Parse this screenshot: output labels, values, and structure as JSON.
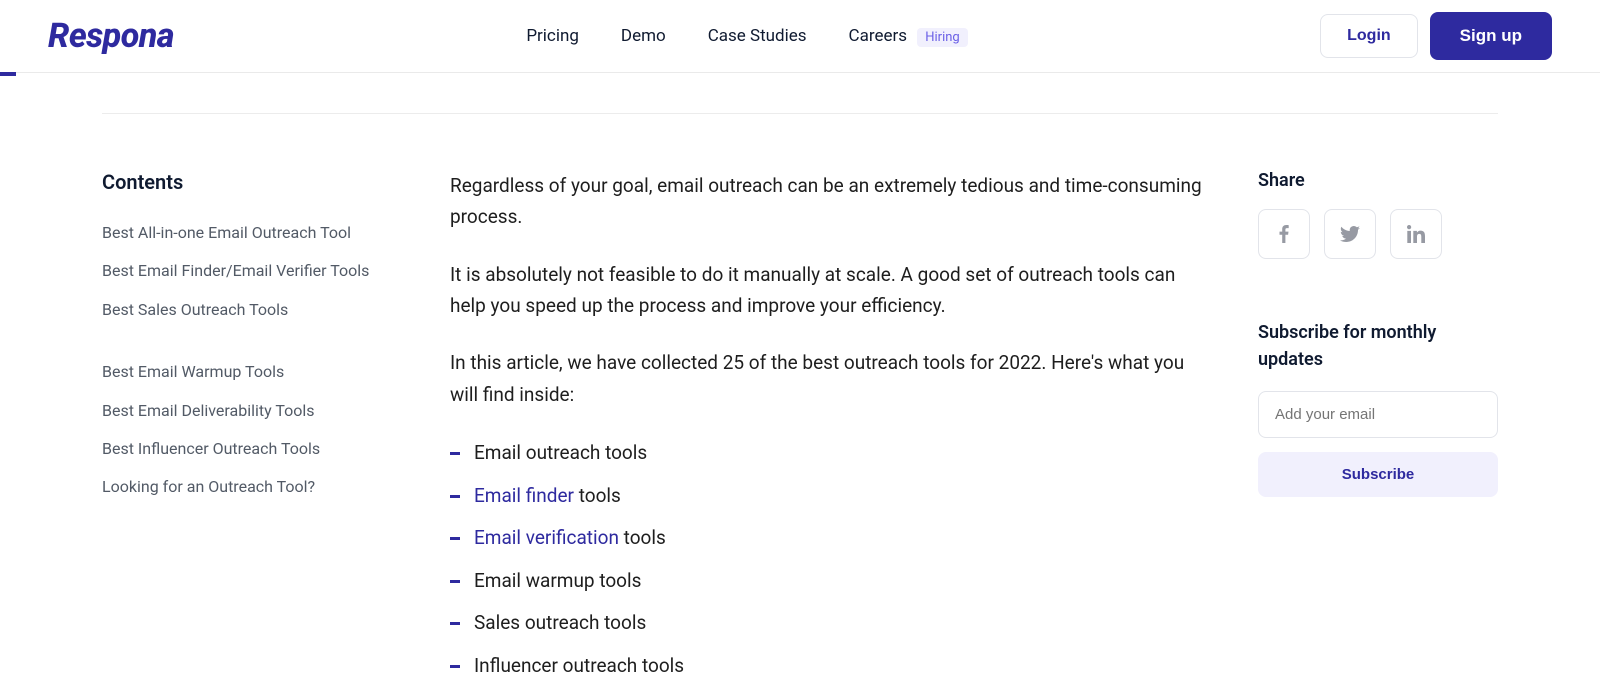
{
  "header": {
    "logo": "Respona",
    "nav": {
      "pricing": "Pricing",
      "demo": "Demo",
      "case_studies": "Case Studies",
      "careers": "Careers",
      "hiring_badge": "Hiring"
    },
    "auth": {
      "login": "Login",
      "signup": "Sign up"
    }
  },
  "contents": {
    "heading": "Contents",
    "items": [
      "Best All-in-one Email Outreach Tool",
      "Best Email Finder/Email Verifier Tools",
      "Best Sales Outreach Tools",
      "Best Email Warmup Tools",
      "Best Email Deliverability Tools",
      "Best Influencer Outreach Tools",
      "Looking for an Outreach Tool?"
    ]
  },
  "article": {
    "p1": "Regardless of your goal, email outreach can be an extremely tedious and time-consuming process.",
    "p2": "It is absolutely not feasible to do it manually at scale. A good set of outreach tools can help you speed up the process and improve your efficiency.",
    "p3": "In this article, we have collected 25 of the best outreach tools for 2022. Here's what you will find inside:",
    "bullets": [
      {
        "pre": "Email outreach tools",
        "link": "",
        "post": ""
      },
      {
        "pre": "",
        "link": "Email finder",
        "post": " tools"
      },
      {
        "pre": "",
        "link": "Email verification",
        "post": " tools"
      },
      {
        "pre": "Email warmup tools",
        "link": "",
        "post": ""
      },
      {
        "pre": "Sales outreach tools",
        "link": "",
        "post": ""
      },
      {
        "pre": "Influencer outreach tools",
        "link": "",
        "post": ""
      }
    ]
  },
  "share": {
    "heading": "Share"
  },
  "subscribe": {
    "heading": "Subscribe for monthly updates",
    "placeholder": "Add your email",
    "button": "Subscribe"
  }
}
